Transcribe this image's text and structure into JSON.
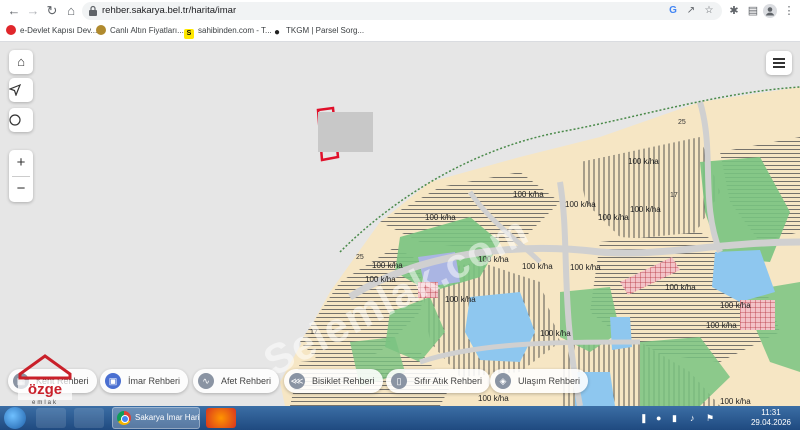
{
  "browser": {
    "url": "rehber.sakarya.bel.tr/harita/imar",
    "bookmarks": [
      {
        "label": "e-Devlet Kapısı Dev...",
        "icon": "edevlet-icon"
      },
      {
        "label": "Canlı Altın Fiyatları...",
        "icon": "gold-icon"
      },
      {
        "label": "sahibinden.com - T...",
        "icon": "sahibinden-icon"
      },
      {
        "label": "TKGM | Parsel Sorg...",
        "icon": "location-pin-icon"
      }
    ]
  },
  "map": {
    "labels": {
      "density": "100 k/ha",
      "contour_25": "25",
      "contour_17": "17",
      "marker_b": "b"
    },
    "watermark": "Selemlak.com"
  },
  "guides": [
    {
      "label": "Kent Rehberi",
      "icon": "city-icon",
      "active": false
    },
    {
      "label": "İmar Rehberi",
      "icon": "building-icon",
      "active": true
    },
    {
      "label": "Afet Rehberi",
      "icon": "pulse-icon",
      "active": false
    },
    {
      "label": "Bisiklet Rehberi",
      "icon": "share-icon",
      "active": false
    },
    {
      "label": "Sıfır Atık Rehberi",
      "icon": "trash-icon",
      "active": false
    },
    {
      "label": "Ulaşım Rehberi",
      "icon": "compass-icon",
      "active": false
    }
  ],
  "logo": {
    "brand": "özge",
    "tagline": "emlak"
  },
  "taskbar": {
    "active_window": "Sakarya İmar Hari...",
    "time": "11:31",
    "date": "29.04.2026"
  },
  "colors": {
    "residential": "#f6e6c4",
    "green": "#79c381",
    "water": "#8ec7ef",
    "road": "#d6d6d6",
    "selection": "#e0102a",
    "active_guide": "#4a6fd1"
  }
}
